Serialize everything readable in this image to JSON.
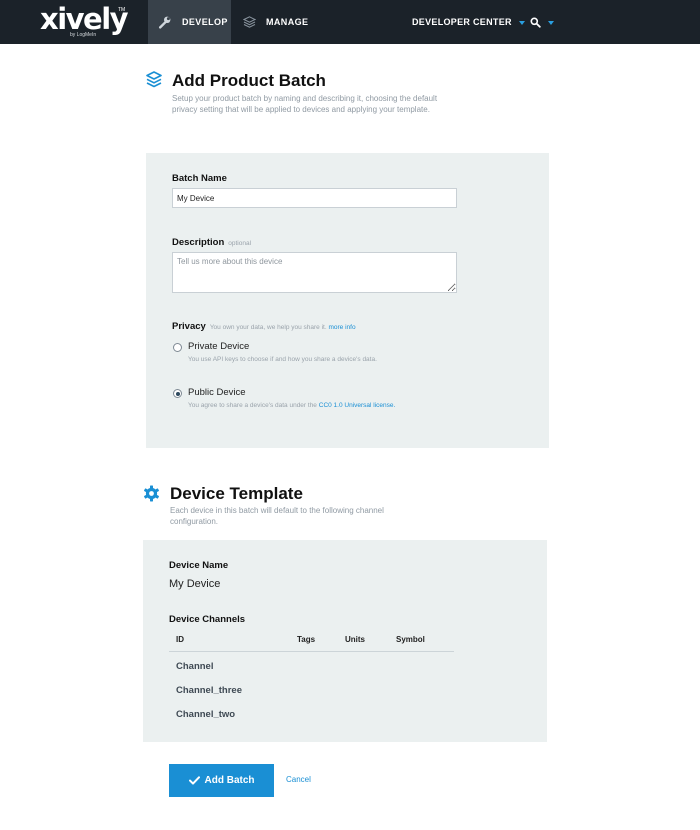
{
  "app": {
    "logo_text": "xively",
    "logo_tm": "TM",
    "logo_sub": "by LogMeIn"
  },
  "nav": {
    "develop": "DEVELOP",
    "manage": "MANAGE",
    "developer_center": "DEVELOPER CENTER",
    "icons": [
      "wrench-icon",
      "layers-icon",
      "search-icon"
    ]
  },
  "product_batch": {
    "title": "Add Product Batch",
    "description": "Setup your product batch by naming and describing it, choosing the default privacy setting that will be applied to devices and applying your template.",
    "icon": "layers-icon",
    "batch_name_label": "Batch Name",
    "batch_name_value": "My Device",
    "description_label": "Description",
    "description_hint": "optional",
    "description_placeholder": "Tell us more about this device",
    "privacy_label": "Privacy",
    "privacy_hint": "You own your data, we help you share it.",
    "privacy_link": "more info",
    "private_option": {
      "label": "Private Device",
      "desc": "You use API keys to choose if and how you share a device's data.",
      "checked": false
    },
    "public_option": {
      "label": "Public Device",
      "desc": "You agree to share a device's data under the",
      "license_link": "CC0 1.0 Universal license.",
      "checked": true
    }
  },
  "device_template": {
    "title": "Device Template",
    "description": "Each device in this batch will default to the following channel configuration.",
    "icon": "gear-icon",
    "device_name_label": "Device Name",
    "device_name_value": "My Device",
    "channels_label": "Device Channels",
    "columns": [
      "ID",
      "Tags",
      "Units",
      "Symbol"
    ],
    "channels": [
      "Channel",
      "Channel_three",
      "Channel_two"
    ]
  },
  "actions": {
    "add_batch": "Add Batch",
    "cancel": "Cancel"
  },
  "colors": {
    "topbar": "#1b2229",
    "active_tab": "#38414a",
    "accent": "#1a8fd4",
    "panel": "#ebf0f0"
  }
}
